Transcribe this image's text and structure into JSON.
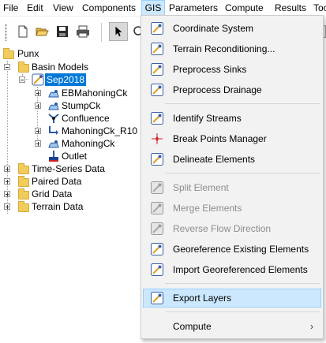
{
  "menubar": {
    "items": [
      {
        "label": "File"
      },
      {
        "label": "Edit"
      },
      {
        "label": "View"
      },
      {
        "label": "Components"
      },
      {
        "label": "GIS"
      },
      {
        "label": "Parameters"
      },
      {
        "label": "Compute"
      },
      {
        "label": "Results"
      },
      {
        "label": "Too"
      }
    ]
  },
  "tree": {
    "root": "Punx",
    "basin_models": "Basin Models",
    "selected_model": "Sep2018",
    "elements": [
      {
        "label": "EBMahoningCk"
      },
      {
        "label": "StumpCk"
      },
      {
        "label": "Confluence"
      },
      {
        "label": "MahoningCk_R10"
      },
      {
        "label": "MahoningCk"
      },
      {
        "label": "Outlet"
      }
    ],
    "folders": [
      {
        "label": "Time-Series Data"
      },
      {
        "label": "Paired Data"
      },
      {
        "label": "Grid Data"
      },
      {
        "label": "Terrain Data"
      }
    ]
  },
  "gis_menu": {
    "items": [
      {
        "label": "Coordinate System",
        "icon": "wand-icon",
        "enabled": true
      },
      {
        "label": "Terrain Reconditioning...",
        "icon": "wand-icon",
        "enabled": true
      },
      {
        "label": "Preprocess Sinks",
        "icon": "wand-icon",
        "enabled": true
      },
      {
        "label": "Preprocess Drainage",
        "icon": "wand-icon",
        "enabled": true
      },
      {
        "label": "Identify Streams",
        "icon": "wand-icon",
        "enabled": true
      },
      {
        "label": "Break Points Manager",
        "icon": "breakpoint-icon",
        "enabled": true
      },
      {
        "label": "Delineate Elements",
        "icon": "wand-icon",
        "enabled": true
      },
      {
        "label": "Split Element",
        "icon": "wand-icon",
        "enabled": false
      },
      {
        "label": "Merge Elements",
        "icon": "wand-icon",
        "enabled": false
      },
      {
        "label": "Reverse Flow Direction",
        "icon": "wand-icon",
        "enabled": false
      },
      {
        "label": "Georeference Existing Elements",
        "icon": "wand-icon",
        "enabled": true
      },
      {
        "label": "Import Georeferenced Elements",
        "icon": "wand-icon",
        "enabled": true
      },
      {
        "label": "Export Layers",
        "icon": "wand-icon",
        "enabled": true,
        "highlighted": true
      },
      {
        "label": "Compute",
        "submenu_arrow": "›",
        "enabled": true
      }
    ]
  },
  "colors": {
    "selection": "#0078d7",
    "menu_highlight": "#cce8ff",
    "menu_highlight_border": "#99d1ff",
    "folder": "#f2cc5b"
  }
}
